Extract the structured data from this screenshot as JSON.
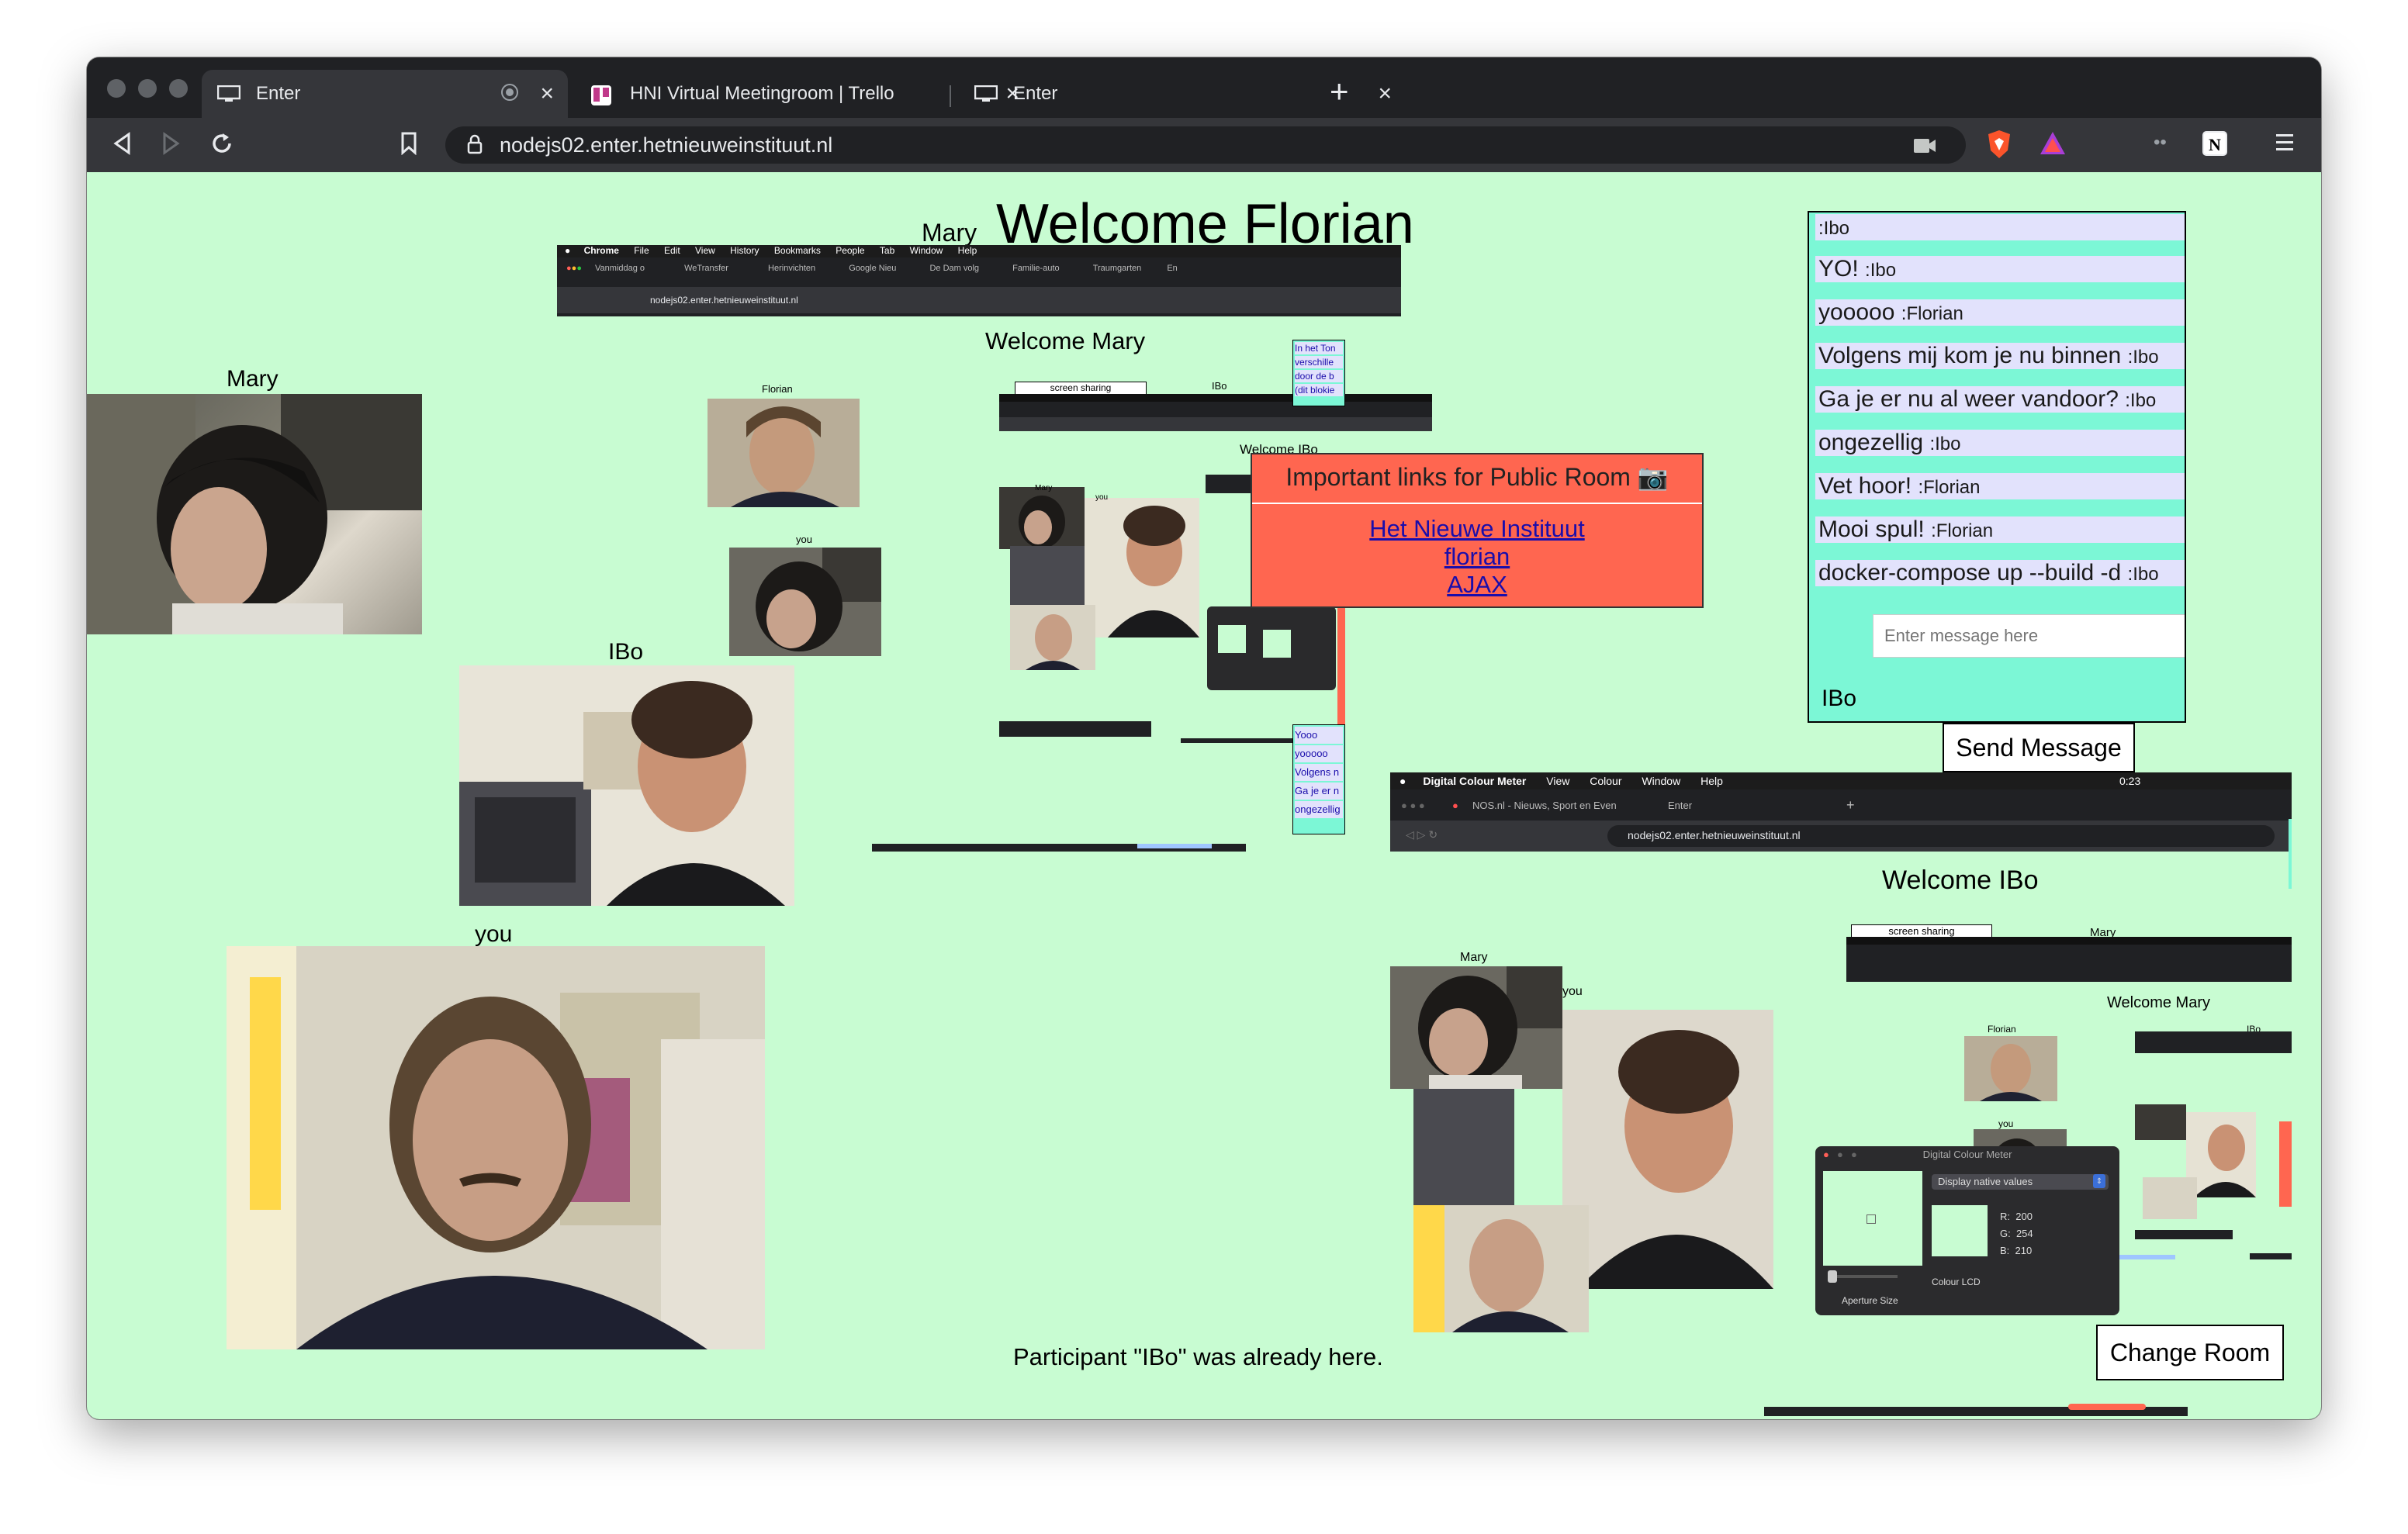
{
  "browser": {
    "tabs": [
      {
        "title": "Enter",
        "active": true
      },
      {
        "title": "HNI Virtual Meetingroom | Trello",
        "active": false
      },
      {
        "title": "Enter",
        "active": false
      }
    ],
    "url": "nodejs02.enter.hetnieuweinstituut.nl"
  },
  "page": {
    "welcome": "Welcome Florian",
    "welcome_prefix_name": "Mary",
    "videos": {
      "mary": "Mary",
      "ibo": "IBo",
      "you": "you"
    },
    "notice": "Participant \"IBo\" was already here.",
    "change_room": "Change Room",
    "links_panel": {
      "title": "Important links for Public Room 📷",
      "links": [
        "Het Nieuwe Instituut",
        "florian",
        "AJAX"
      ]
    },
    "chat": {
      "messages": [
        {
          "text": "",
          "who": ":Ibo"
        },
        {
          "text": "YO!",
          "who": ":Ibo"
        },
        {
          "text": "yooooo",
          "who": ":Florian"
        },
        {
          "text": "Volgens mij kom je nu binnen",
          "who": ":Ibo"
        },
        {
          "text": "Ga je er nu al weer vandoor?",
          "who": ":Ibo"
        },
        {
          "text": "ongezellig",
          "who": ":Ibo"
        },
        {
          "text": "Vet hoor!",
          "who": ":Florian"
        },
        {
          "text": "Mooi spul!",
          "who": ":Florian"
        },
        {
          "text": "docker-compose up --build -d",
          "who": ":Ibo"
        }
      ],
      "input_placeholder": "Enter message here",
      "send_label": "Send Message",
      "name_label": "IBo"
    },
    "nested_mary": {
      "welcome": "Welcome Mary",
      "labels": {
        "florian": "Florian",
        "you": "you",
        "ibo": "IBo",
        "welcome_ibo": "Welcome IBo"
      },
      "menubar": [
        "Chrome",
        "File",
        "Edit",
        "View",
        "History",
        "Bookmarks",
        "People",
        "Tab",
        "Window",
        "Help"
      ],
      "tabs": [
        "Vanmiddag o",
        "WeTransfer",
        "Herinvichten",
        "Google Nieu",
        "De Dam volg",
        "Familie-auto",
        "Traumgarten",
        "En"
      ],
      "url": "nodejs02.enter.hetnieuweinstituut.nl",
      "side_chat": [
        "In het Ton",
        "verschille",
        "door de b",
        "(dit blokie"
      ],
      "side_chat_lower": [
        "Yooo",
        "yooooo",
        "Volgens n",
        "Ga je er n",
        "ongezellig"
      ],
      "screen_sharing": "screen sharing"
    },
    "nested_ibo": {
      "welcome": "Welcome IBo",
      "menubar": [
        "Digital Colour Meter",
        "View",
        "Colour",
        "Window",
        "Help"
      ],
      "tab_title": "NOS.nl - Nieuws, Sport en Even",
      "tab2": "Enter",
      "url": "nodejs02.enter.hetnieuweinstituut.nl",
      "time": "0:23",
      "labels": {
        "mary": "Mary",
        "you": "you",
        "mary2": "Mary",
        "welcome_mary": "Welcome Mary",
        "florian": "Florian",
        "ibo": "IBo",
        "you2": "you",
        "screen_sharing": "screen sharing"
      },
      "colour_meter": {
        "title": "Digital Colour Meter",
        "mode": "Display native values",
        "r": "200",
        "g": "254",
        "b": "210",
        "aperture": "Aperture Size",
        "lcd": "Colour LCD"
      }
    },
    "colors": {
      "page_bg": "#c8fcd2",
      "chat_bg": "#7cf7d6",
      "links_bg": "#ff6650",
      "msg_bg": "#e2e2fc"
    }
  }
}
